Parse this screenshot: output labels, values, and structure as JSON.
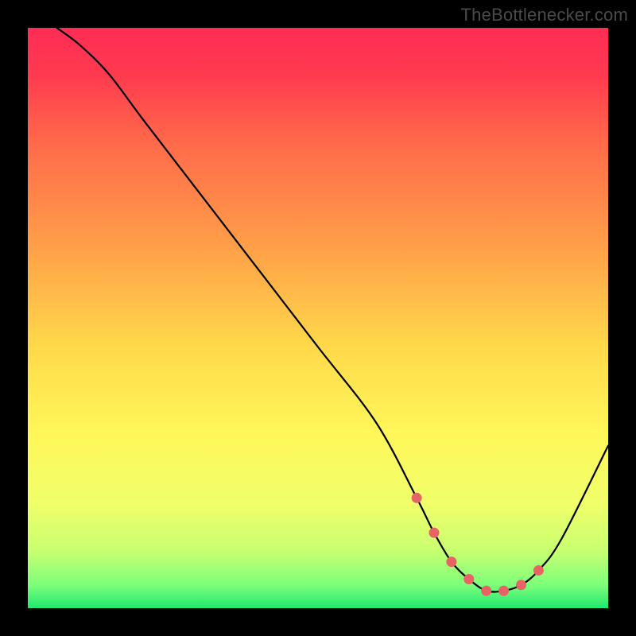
{
  "watermark": "TheBottlenecker.com",
  "chart_data": {
    "type": "line",
    "title": "",
    "xlabel": "",
    "ylabel": "",
    "xlim": [
      0,
      100
    ],
    "ylim": [
      0,
      100
    ],
    "gradient_stops": [
      {
        "offset": 0.0,
        "color": "#ff2d55"
      },
      {
        "offset": 0.08,
        "color": "#ff3a4f"
      },
      {
        "offset": 0.2,
        "color": "#ff6a4a"
      },
      {
        "offset": 0.38,
        "color": "#ffa048"
      },
      {
        "offset": 0.55,
        "color": "#ffd94a"
      },
      {
        "offset": 0.7,
        "color": "#fff75a"
      },
      {
        "offset": 0.82,
        "color": "#f0ff6a"
      },
      {
        "offset": 0.9,
        "color": "#c9ff70"
      },
      {
        "offset": 0.96,
        "color": "#7dff7a"
      },
      {
        "offset": 1.0,
        "color": "#20e870"
      }
    ],
    "curve": {
      "x": [
        5,
        9,
        14,
        20,
        30,
        40,
        50,
        60,
        67,
        70,
        73,
        76,
        79,
        82,
        85,
        88,
        92,
        100
      ],
      "y": [
        100,
        97,
        92,
        84,
        71,
        58,
        45,
        32,
        19,
        13,
        8,
        5,
        3,
        3,
        4,
        6.5,
        12,
        28
      ]
    },
    "markers": {
      "x": [
        67,
        70,
        73,
        76,
        79,
        82,
        85,
        88
      ],
      "y": [
        19,
        13,
        8,
        5,
        3,
        3,
        4,
        6.5
      ]
    },
    "marker_radius": 6.5
  }
}
